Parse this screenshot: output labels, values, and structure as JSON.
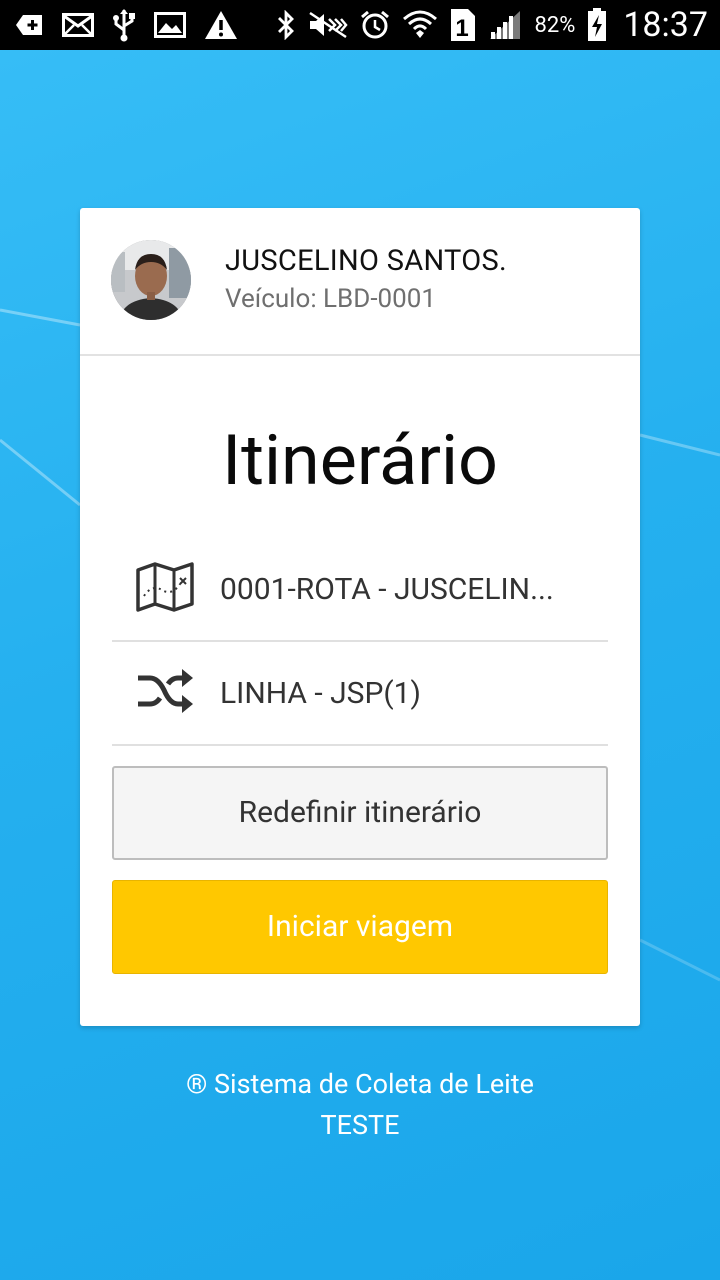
{
  "status_bar": {
    "battery_percent": "82%",
    "sim_slot": "1",
    "time": "18:37",
    "left_icons": [
      "add-icon",
      "mail-icon",
      "usb-icon",
      "image-icon",
      "warning-icon"
    ],
    "right_icons": [
      "bluetooth-icon",
      "mute-icon",
      "alarm-icon",
      "wifi-icon",
      "signal-icon",
      "battery-icon"
    ]
  },
  "profile": {
    "name": "JUSCELINO SANTOS.",
    "vehicle": "Veículo: LBD-0001"
  },
  "itinerary": {
    "title": "Itinerário",
    "route": {
      "icon": "map-icon",
      "label": "0001-ROTA - JUSCELIN..."
    },
    "line": {
      "icon": "shuffle-icon",
      "label": "LINHA - JSP(1)"
    }
  },
  "actions": {
    "reset_label": "Redefinir itinerário",
    "start_label": "Iniciar viagem"
  },
  "footer": {
    "line1": "® Sistema de Coleta de Leite",
    "line2": "TESTE"
  },
  "colors": {
    "background": "#1fb0ef",
    "accent_button": "#ffc800",
    "card": "#ffffff"
  }
}
